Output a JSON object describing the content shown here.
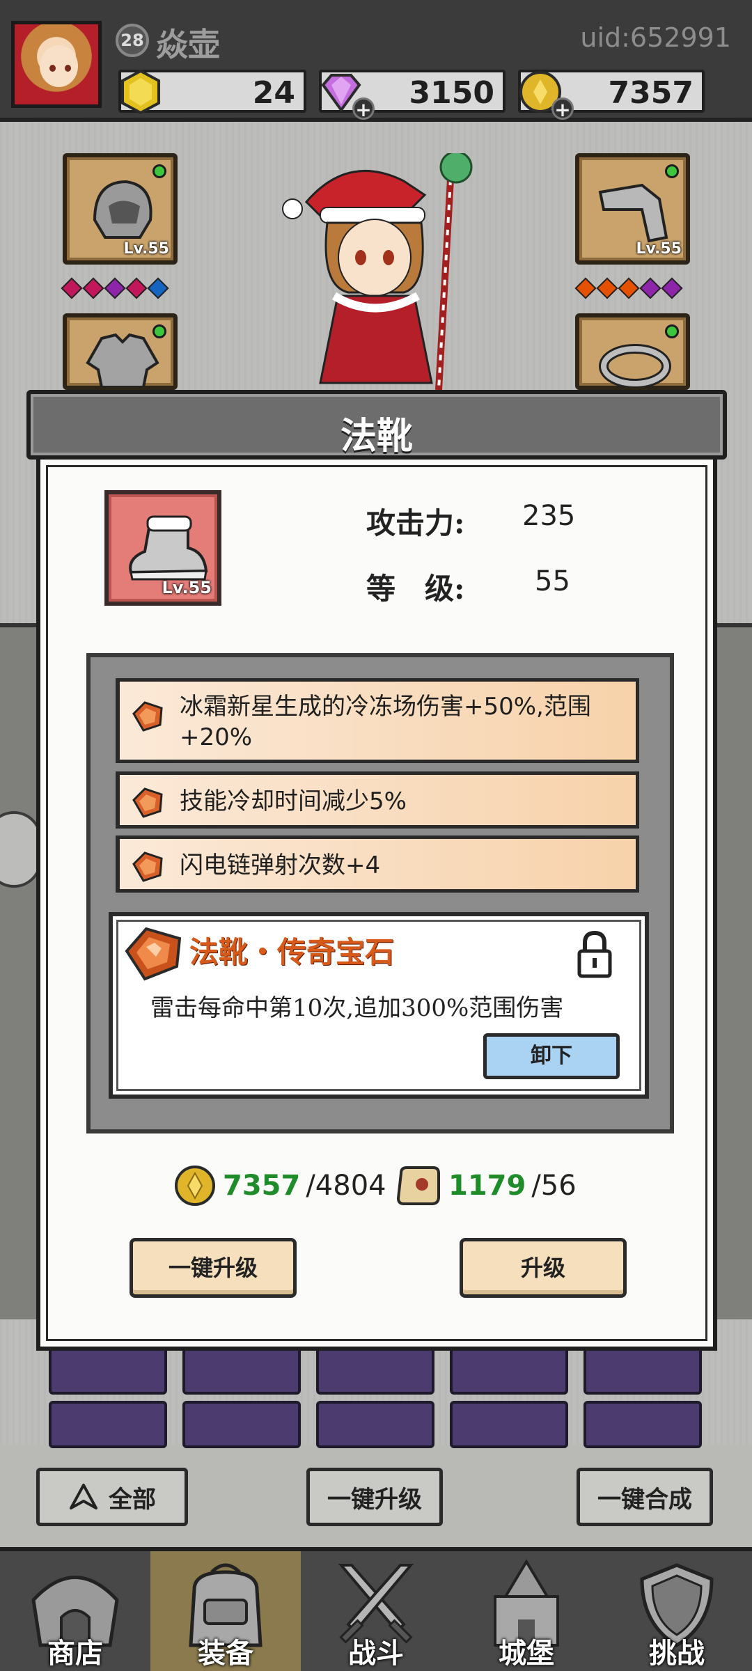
{
  "header": {
    "level": "28",
    "username": "焱壶",
    "uid": "uid:652991",
    "resources": [
      {
        "name": "gold-gem",
        "value": "24",
        "color": "#d4b21f"
      },
      {
        "name": "diamond",
        "value": "3150",
        "color": "#b35ad0"
      },
      {
        "name": "coin",
        "value": "7357",
        "color": "#d9a81f"
      }
    ]
  },
  "equipment": {
    "slots": [
      {
        "name": "helmet",
        "level": "Lv.55"
      },
      {
        "name": "bracer",
        "level": "Lv.55"
      },
      {
        "name": "armor",
        "level": ""
      },
      {
        "name": "ring",
        "level": ""
      }
    ],
    "left_gems": [
      "#c2185b",
      "#c2185b",
      "#8e24aa",
      "#c2185b",
      "#1565c0"
    ],
    "right_gems": [
      "#e65100",
      "#e65100",
      "#e65100",
      "#8e24aa",
      "#8e24aa"
    ]
  },
  "modal": {
    "title": "法靴",
    "item_level": "Lv.55",
    "stats": [
      {
        "label": "攻击力:",
        "value": "235"
      },
      {
        "label": "等　级:",
        "value": "55"
      }
    ],
    "affixes": [
      "冰霜新星生成的冷冻场伤害+50%,范围+20%",
      "技能冷却时间减少5%",
      "闪电链弹射次数+4"
    ],
    "legendary": {
      "title": "法靴・传奇宝石",
      "desc": "雷击每命中第10次,追加300%范围伤害",
      "unload_label": "卸下"
    },
    "costs": [
      {
        "have": "7357",
        "need": "/4804"
      },
      {
        "have": "1179",
        "need": "/56"
      }
    ],
    "buttons": {
      "one_click_upgrade": "一键升级",
      "upgrade": "升级"
    }
  },
  "controls": {
    "all": "全部",
    "one_click_upgrade": "一键升级",
    "one_click_merge": "一键合成"
  },
  "nav": [
    {
      "label": "商店",
      "icon": "shop-icon"
    },
    {
      "label": "装备",
      "icon": "backpack-icon"
    },
    {
      "label": "战斗",
      "icon": "swords-icon"
    },
    {
      "label": "城堡",
      "icon": "castle-icon"
    },
    {
      "label": "挑战",
      "icon": "shield-icon"
    }
  ]
}
